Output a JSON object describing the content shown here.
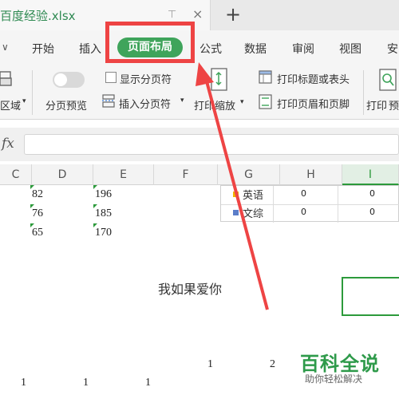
{
  "window": {
    "file_name": "百度经验.xlsx",
    "pin_icon": "pin-icon",
    "close_icon": "close-icon",
    "new_tab_icon": "plus-icon"
  },
  "menu": {
    "overflow_icon": "chevron-down-icon",
    "items": [
      "开始",
      "插入",
      "页面布局",
      "公式",
      "数据",
      "审阅",
      "视图",
      "安"
    ],
    "active_index": 2,
    "active_color": "#3fa45b",
    "highlight_color": "#ee4444"
  },
  "ribbon": {
    "area_label": "区域",
    "page_preview_label": "分页预览",
    "show_page_break_label": "显示分页符",
    "insert_page_break_label": "插入分页符",
    "print_scale_label": "打印缩放",
    "print_titles_label": "打印标题或表头",
    "print_header_footer_label": "打印页眉和页脚",
    "print_label": "打印"
  },
  "formula_bar": {
    "fx_label": "fx",
    "value": ""
  },
  "columns": [
    "C",
    "D",
    "E",
    "F",
    "G",
    "H",
    "I"
  ],
  "sheet": {
    "col_d_values": [
      "82",
      "76",
      "65"
    ],
    "col_e_values": [
      "196",
      "185",
      "170"
    ],
    "mini_table": {
      "rows": [
        {
          "label": "英语",
          "color": "#f0b400",
          "h": "0",
          "i": "0"
        },
        {
          "label": "文综",
          "color": "#5b7ec9",
          "h": "0",
          "i": "0"
        }
      ]
    },
    "note_text": "我如果爱你",
    "row_numbers_upper": [
      "1",
      "2"
    ],
    "row_numbers_lower": [
      "1",
      "1",
      "1"
    ]
  },
  "watermark": {
    "title": "百科全说",
    "subtitle": "助你轻松解决"
  },
  "accent_green": "#2c9a3b"
}
